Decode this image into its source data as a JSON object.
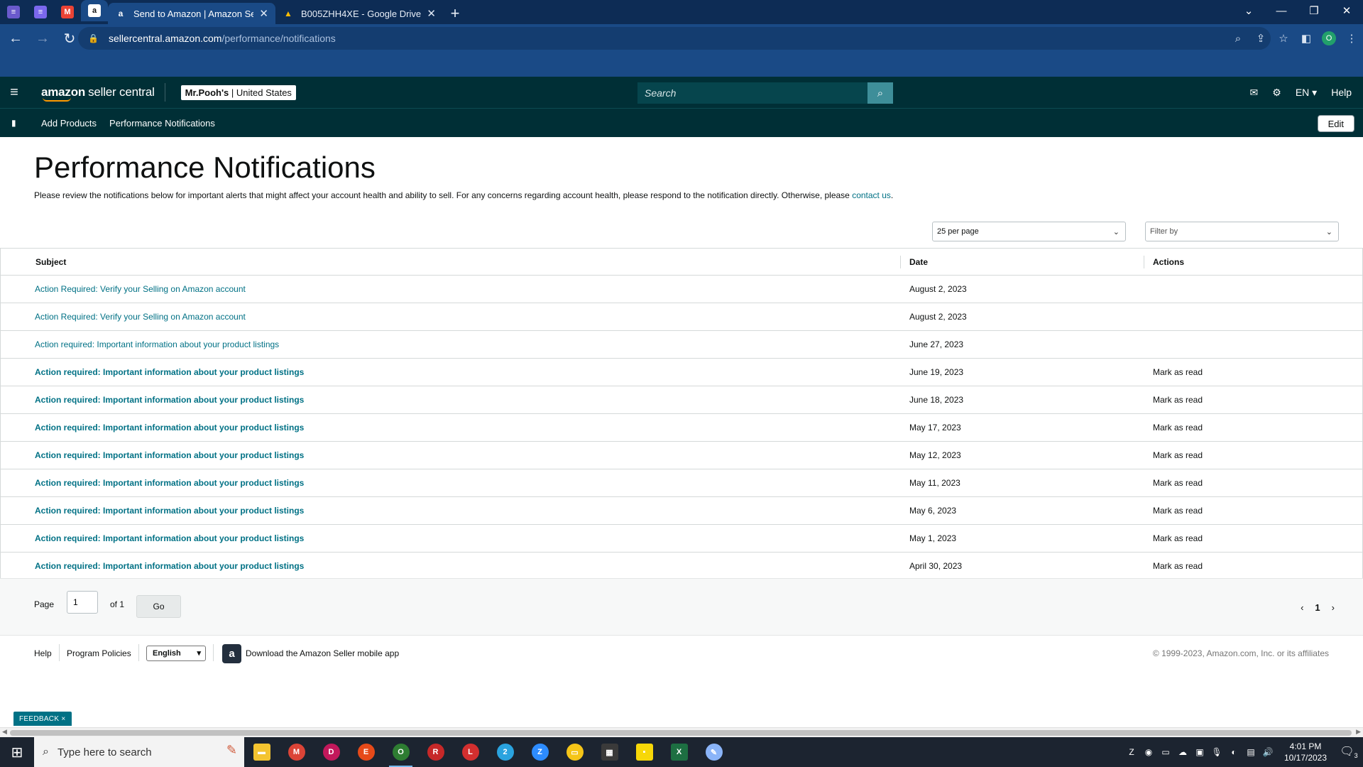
{
  "browser": {
    "pinned_tabs": [
      {
        "icon": "list-app-icon",
        "color": "#6a5acd",
        "glyph": "≡"
      },
      {
        "icon": "list-app-icon",
        "color": "#7b68ee",
        "glyph": "≡"
      },
      {
        "icon": "gmail-icon",
        "color": "#ea4335",
        "glyph": "M"
      },
      {
        "icon": "amazon-icon",
        "color": "#ffffff",
        "glyph": "a"
      }
    ],
    "tabs": [
      {
        "title": "Send to Amazon | Amazon Seller",
        "icon": "amazon-icon",
        "glyph": "a",
        "active": true
      },
      {
        "title": "B005ZHH4XE - Google Drive",
        "icon": "google-drive-icon",
        "glyph": "▲",
        "active": false
      }
    ],
    "url_host": "sellercentral.amazon.com",
    "url_path": "/performance/notifications",
    "profile_initial": "O"
  },
  "header": {
    "logo_bold": "amazon",
    "logo_rest": "seller central",
    "merchant_name": "Mr.Pooh's",
    "merchant_sep": " | ",
    "merchant_region": "United States",
    "search_placeholder": "Search",
    "language": "EN ▾",
    "help": "Help"
  },
  "subnav": {
    "items": [
      "Add Products",
      "Performance Notifications"
    ],
    "edit_label": "Edit"
  },
  "main": {
    "title": "Performance Notifications",
    "intro_text": "Please review the notifications below for important alerts that might affect your account health and ability to sell. For any concerns regarding account health, please respond to the notification directly. Otherwise, please ",
    "intro_link": "contact us",
    "intro_end": ".",
    "per_page": "25 per page",
    "filter_placeholder": "Filter by",
    "columns": {
      "subject": "Subject",
      "date": "Date",
      "actions": "Actions"
    },
    "rows": [
      {
        "subject": "Action Required: Verify your Selling on Amazon account",
        "date": "August 2, 2023",
        "action": "",
        "unread": false
      },
      {
        "subject": "Action Required: Verify your Selling on Amazon account",
        "date": "August 2, 2023",
        "action": "",
        "unread": false
      },
      {
        "subject": "Action required: Important information about your product listings",
        "date": "June 27, 2023",
        "action": "",
        "unread": false
      },
      {
        "subject": "Action required: Important information about your product listings",
        "date": "June 19, 2023",
        "action": "Mark as read",
        "unread": true
      },
      {
        "subject": "Action required: Important information about your product listings",
        "date": "June 18, 2023",
        "action": "Mark as read",
        "unread": true
      },
      {
        "subject": "Action required: Important information about your product listings",
        "date": "May 17, 2023",
        "action": "Mark as read",
        "unread": true
      },
      {
        "subject": "Action required: Important information about your product listings",
        "date": "May 12, 2023",
        "action": "Mark as read",
        "unread": true
      },
      {
        "subject": "Action required: Important information about your product listings",
        "date": "May 11, 2023",
        "action": "Mark as read",
        "unread": true
      },
      {
        "subject": "Action required: Important information about your product listings",
        "date": "May 6, 2023",
        "action": "Mark as read",
        "unread": true
      },
      {
        "subject": "Action required: Important information about your product listings",
        "date": "May 1, 2023",
        "action": "Mark as read",
        "unread": true
      },
      {
        "subject": "Action required: Important information about your product listings",
        "date": "April 30, 2023",
        "action": "Mark as read",
        "unread": true
      }
    ],
    "pager": {
      "label": "Page",
      "value": "1",
      "of": "of 1",
      "go": "Go",
      "current": "1"
    }
  },
  "footer": {
    "help": "Help",
    "policies": "Program Policies",
    "language": "English",
    "app_text": "Download the Amazon Seller mobile app",
    "copyright": "© 1999-2023, Amazon.com, Inc. or its affiliates",
    "feedback": "FEEDBACK ×"
  },
  "taskbar": {
    "search_placeholder": "Type here to search",
    "apps": [
      {
        "name": "file-explorer-icon",
        "color": "#f4c430",
        "glyph": "▬",
        "square": true
      },
      {
        "name": "chrome-m-icon",
        "color": "#db4437",
        "glyph": "M"
      },
      {
        "name": "chrome-d-icon",
        "color": "#c2185b",
        "glyph": "D"
      },
      {
        "name": "chrome-e-icon",
        "color": "#e64a19",
        "glyph": "E"
      },
      {
        "name": "chrome-o-icon",
        "color": "#2e7d32",
        "glyph": "O",
        "on": true
      },
      {
        "name": "chrome-r-icon",
        "color": "#c62828",
        "glyph": "R"
      },
      {
        "name": "chrome-l-icon",
        "color": "#d32f2f",
        "glyph": "L"
      },
      {
        "name": "telegram-icon",
        "color": "#2aa3df",
        "glyph": "2"
      },
      {
        "name": "zoom-icon",
        "color": "#2d8cff",
        "glyph": "Z"
      },
      {
        "name": "toolbox-icon",
        "color": "#f5c518",
        "glyph": "▭"
      },
      {
        "name": "calculator-icon",
        "color": "#3a3a3a",
        "glyph": "▦",
        "square": true
      },
      {
        "name": "sticky-notes-icon",
        "color": "#f7d708",
        "glyph": "▪",
        "square": true
      },
      {
        "name": "excel-icon",
        "color": "#1d6f42",
        "glyph": "X",
        "square": true
      },
      {
        "name": "paint-icon",
        "color": "#8ab4f8",
        "glyph": "✎"
      }
    ],
    "time": "4:01 PM",
    "date": "10/17/2023",
    "notifications": "3"
  }
}
